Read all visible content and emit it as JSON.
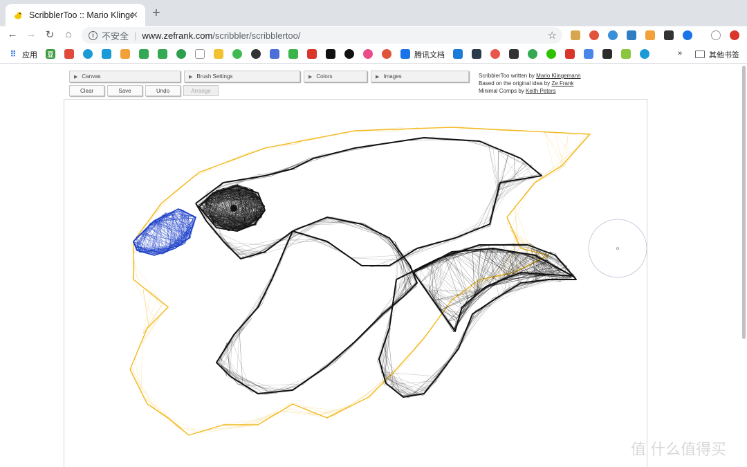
{
  "browser": {
    "tab_title": "ScribblerToo :: Mario Klingemann",
    "tab_close": "✕",
    "new_tab": "+",
    "url_security": "不安全",
    "url_separator": "|",
    "url_host": "www.zefrank.com",
    "url_path": "/scribbler/scribblertoo/",
    "bookmarks": {
      "apps_label": "应用",
      "tencent_docs": "腾讯文档",
      "more": "»",
      "other_bookmarks": "其他书签"
    }
  },
  "app": {
    "menus": {
      "canvas": "Canvas",
      "brush_settings": "Brush Settings",
      "colors": "Colors",
      "images": "Images"
    },
    "actions": {
      "clear": "Clear",
      "save": "Save",
      "undo": "Undo",
      "arrange": "Arrange"
    },
    "credits": {
      "line1_prefix": "ScribblerToo written by ",
      "line1_link": "Mario Klingemann",
      "line2_prefix": "Based on the original idea by ",
      "line2_link": "Ze Frank",
      "line3_prefix": "Minimal Comps by ",
      "line3_link": "Keith Peters"
    },
    "stroke_colors": {
      "yellow": "#f2b81c",
      "black": "#111111",
      "blue": "#1b3fc7"
    }
  },
  "watermark": "值 什么值得买"
}
